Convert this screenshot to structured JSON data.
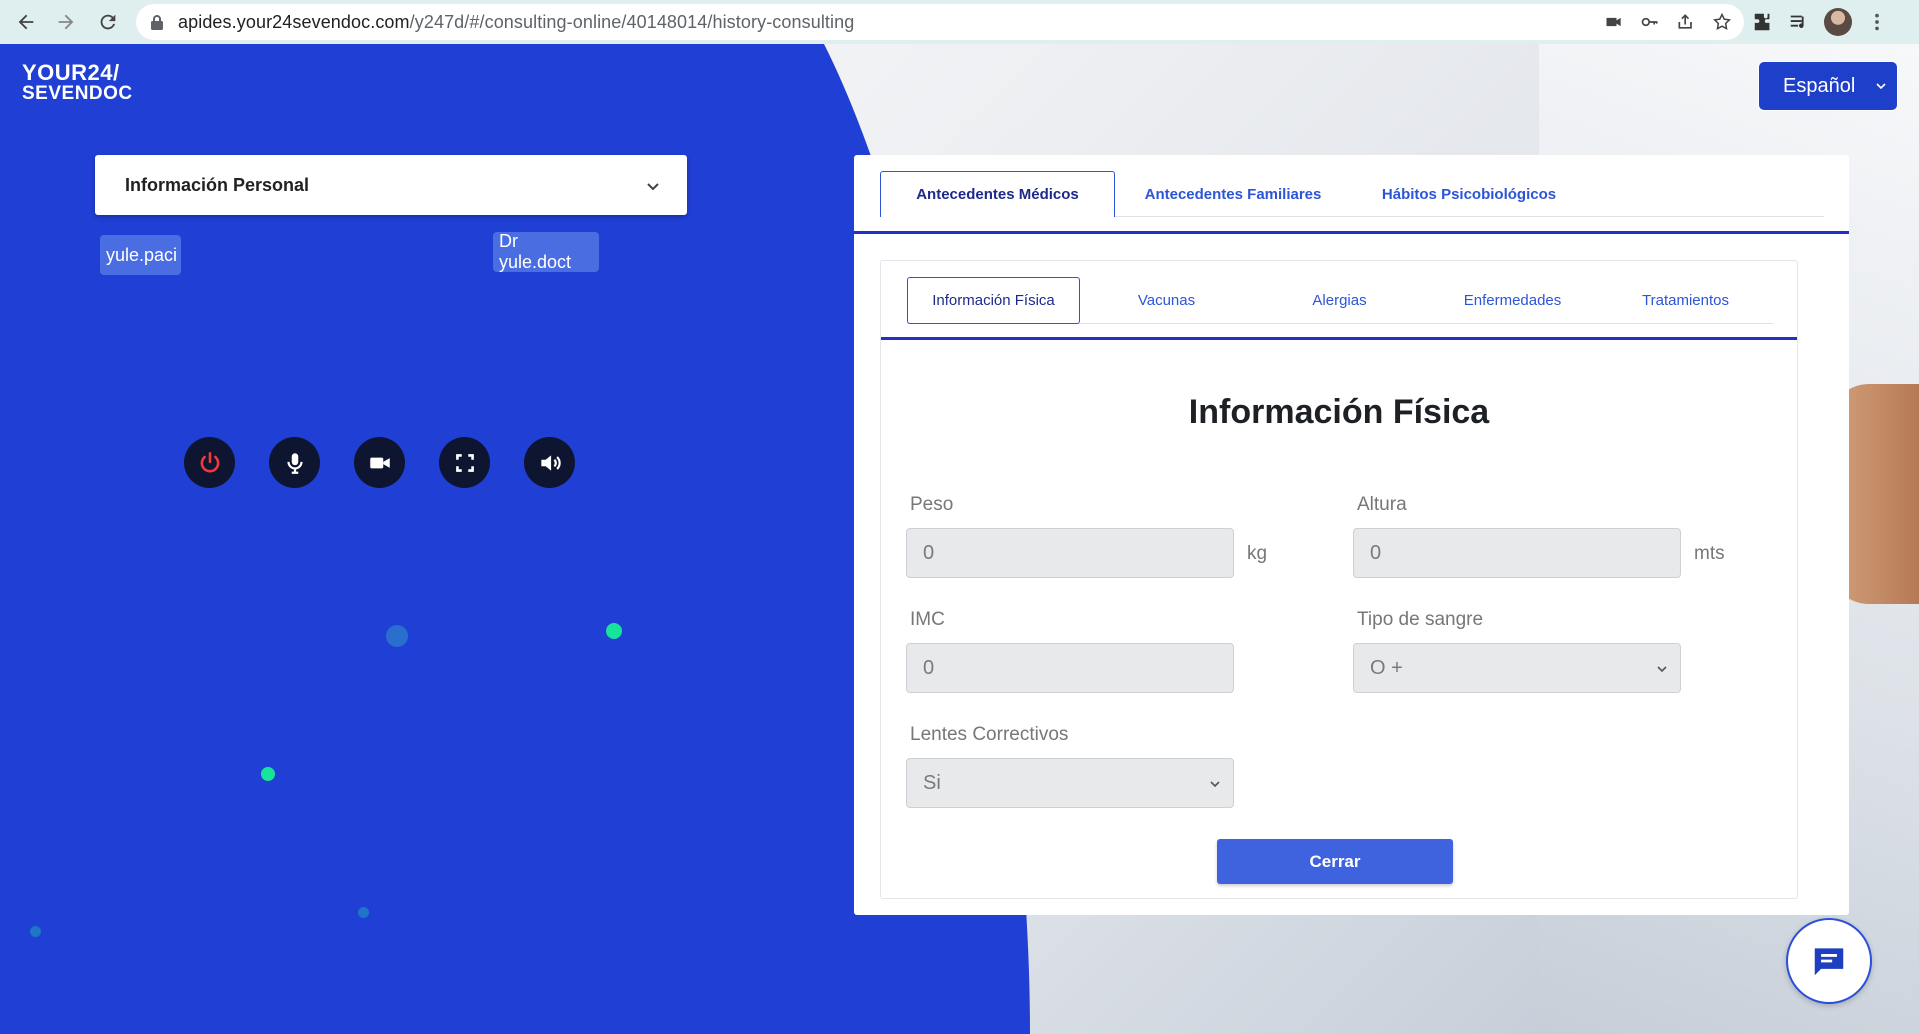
{
  "browser": {
    "url_host": "apides.your24sevendoc.com",
    "url_path": "/y247d/#/consulting-online/40148014/history-consulting"
  },
  "logo": {
    "line1": "YOUR24/",
    "line2": "SEVENDOC"
  },
  "language": {
    "selected": "Español"
  },
  "left": {
    "personal_info_label": "Información Personal",
    "patient_name": "yule.paci",
    "doctor_name": "Dr yule.doct"
  },
  "modal": {
    "top_tabs": [
      "Antecedentes Médicos",
      "Antecedentes Familiares",
      "Hábitos Psicobiológicos"
    ],
    "sub_tabs": [
      "Información Física",
      "Vacunas",
      "Alergias",
      "Enfermedades",
      "Tratamientos"
    ],
    "title": "Información Física",
    "fields": {
      "peso": {
        "label": "Peso",
        "value": "0",
        "unit": "kg"
      },
      "altura": {
        "label": "Altura",
        "value": "0",
        "unit": "mts"
      },
      "imc": {
        "label": "IMC",
        "value": "0"
      },
      "tipo_sangre": {
        "label": "Tipo de sangre",
        "value": "O +"
      },
      "lentes": {
        "label": "Lentes Correctivos",
        "value": "Si"
      }
    },
    "close_label": "Cerrar"
  },
  "colors": {
    "page_blue": "#203fd4",
    "accent": "#2d55d7",
    "button": "#3f63df",
    "teal_dot": "#18e39a"
  },
  "icons": {
    "control_buttons": [
      "power-icon",
      "microphone-icon",
      "video-camera-icon",
      "fullscreen-icon",
      "speaker-icon"
    ],
    "chat": "chat-bubble-icon"
  }
}
